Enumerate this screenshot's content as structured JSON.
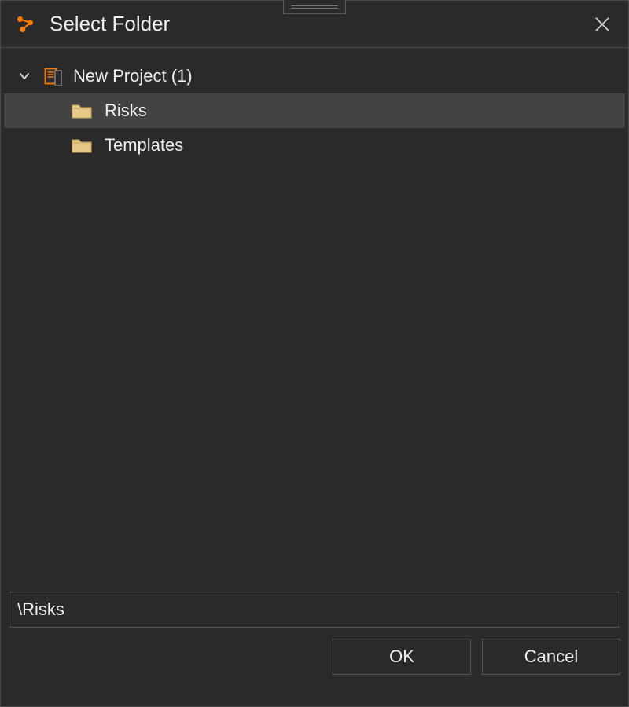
{
  "dialog": {
    "title": "Select Folder"
  },
  "tree": {
    "root": {
      "label": "New Project (1)",
      "expanded": true
    },
    "children": [
      {
        "label": "Risks",
        "selected": true
      },
      {
        "label": "Templates",
        "selected": false
      }
    ]
  },
  "path": {
    "value": "\\Risks"
  },
  "buttons": {
    "ok": "OK",
    "cancel": "Cancel"
  },
  "colors": {
    "accent": "#ff7a00",
    "folder_fill": "#e8c98a",
    "folder_stroke": "#c9a863"
  }
}
